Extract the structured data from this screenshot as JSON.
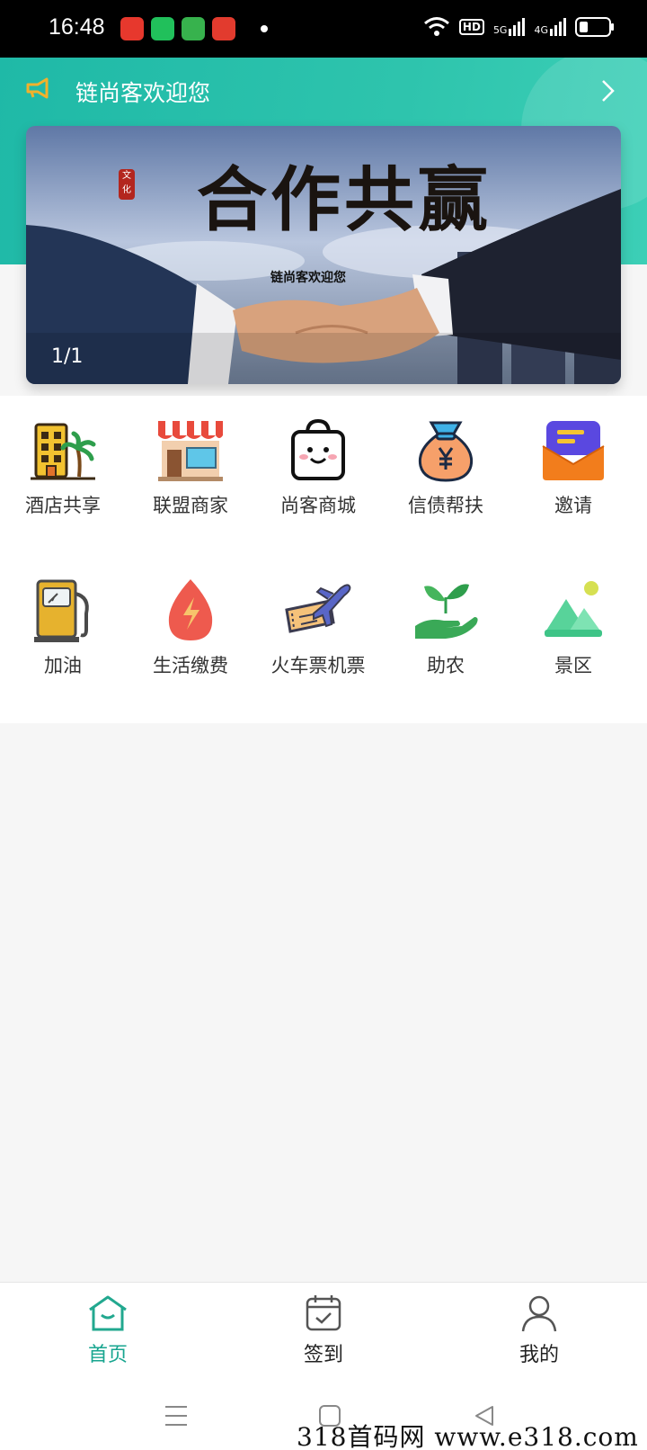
{
  "status_bar": {
    "time": "16:48",
    "hd_badge": "HD",
    "signal_5g": "5G",
    "signal_4g": "4G"
  },
  "header": {
    "notice_text": "链尚客欢迎您",
    "accent": "#1fb9a7"
  },
  "banner": {
    "title": "合作共赢",
    "seal_text": "文化",
    "subtitle": "链尚客欢迎您",
    "counter": "1/1"
  },
  "menu": {
    "items": [
      {
        "label": "酒店共享",
        "icon": "hotel-icon"
      },
      {
        "label": "联盟商家",
        "icon": "store-icon"
      },
      {
        "label": "尚客商城",
        "icon": "shopping-bag-icon"
      },
      {
        "label": "信债帮扶",
        "icon": "money-bag-icon"
      },
      {
        "label": "邀请",
        "icon": "invite-icon"
      },
      {
        "label": "加油",
        "icon": "fuel-pump-icon"
      },
      {
        "label": "生活缴费",
        "icon": "bill-pay-icon"
      },
      {
        "label": "火车票机票",
        "icon": "ticket-plane-icon"
      },
      {
        "label": "助农",
        "icon": "plant-hand-icon"
      },
      {
        "label": "景区",
        "icon": "scenery-icon"
      }
    ]
  },
  "tabbar": {
    "tabs": [
      {
        "label": "首页",
        "icon": "home-icon",
        "active": true
      },
      {
        "label": "签到",
        "icon": "calendar-check-icon",
        "active": false
      },
      {
        "label": "我的",
        "icon": "user-icon",
        "active": false
      }
    ]
  },
  "watermark": "318首码网 www.e318.com"
}
